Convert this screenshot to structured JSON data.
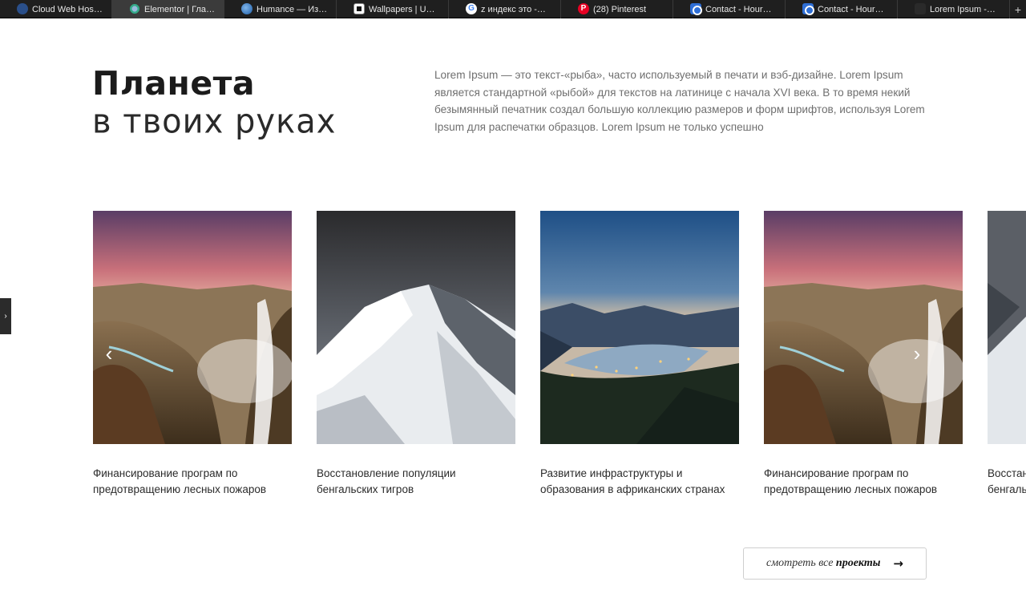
{
  "browser": {
    "tabs": [
      {
        "title": "Cloud Web Hos…",
        "icon": "cloud-hosting-favicon"
      },
      {
        "title": "Elementor | Гла…",
        "icon": "elementor-favicon",
        "active": true
      },
      {
        "title": "Humance — Из…",
        "icon": "globe-favicon"
      },
      {
        "title": "Wallpapers | U…",
        "icon": "unsplash-favicon"
      },
      {
        "title": "z индекс это -…",
        "icon": "google-favicon"
      },
      {
        "title": "(28) Pinterest",
        "icon": "pinterest-favicon"
      },
      {
        "title": "Contact - Hour…",
        "icon": "contact-favicon"
      },
      {
        "title": "Contact - Hour…",
        "icon": "contact-favicon"
      },
      {
        "title": "Lorem Ipsum -…",
        "icon": "lorem-favicon"
      }
    ],
    "new_tab_label": "+"
  },
  "hero": {
    "title_bold": "Планета",
    "title_light": "в твоих руках",
    "intro": "Lorem Ipsum — это текст-«рыба», часто используемый в печати и вэб-дизайне. Lorem Ipsum является стандартной «рыбой» для текстов на латинице с начала XVI века. В то время некий безымянный печатник создал большую коллекцию размеров и форм шрифтов, используя Lorem Ipsum для распечатки образцов. Lorem Ipsum не только успешно"
  },
  "projects": [
    {
      "line1": "Финансирование програм по",
      "line2": "предотвращению лесных пожаров",
      "image": "waterfall-sunset"
    },
    {
      "line1": "Восстановление популяции",
      "line2": "бенгальских тигров",
      "image": "snowy-mountain"
    },
    {
      "line1": "Развитие инфраструктуры и",
      "line2": "образования в африканских странах",
      "image": "night-bay-valley"
    },
    {
      "line1": "Финансирование програм по",
      "line2": "предотвращению лесных пожаров",
      "image": "waterfall-sunset"
    },
    {
      "line1": "Восстановление популяции",
      "line2": "бенгальских тигров",
      "image": "snowy-mountain"
    }
  ],
  "carousel": {
    "prev_icon": "chevron-left-icon",
    "next_icon": "chevron-right-icon"
  },
  "cta": {
    "label_italic": "смотреть все",
    "label_bold": "проекты",
    "icon": "arrow-right-icon"
  },
  "side_panel": {
    "icon": "chevron-right-icon"
  }
}
